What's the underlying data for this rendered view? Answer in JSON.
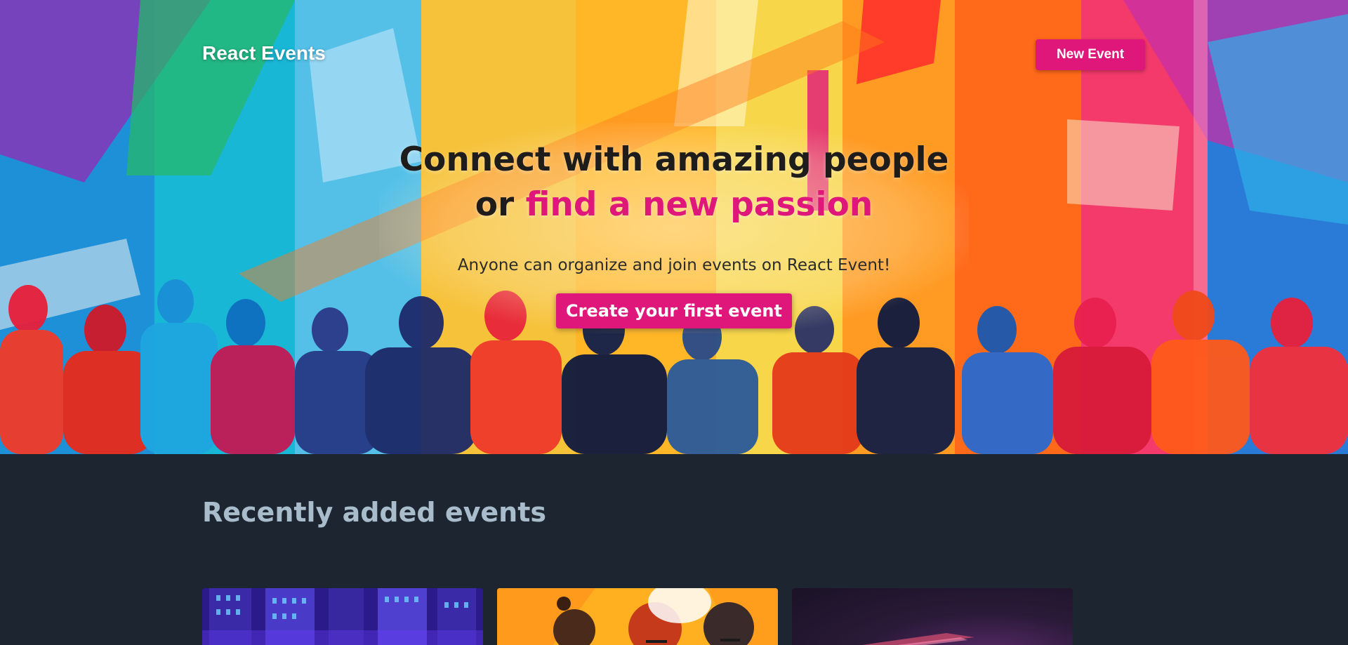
{
  "header": {
    "brand": "React Events",
    "new_event_label": "New Event"
  },
  "hero": {
    "headline_line1": "Connect with amazing people",
    "headline_line2_prefix": "or ",
    "headline_line2_accent": "find a new passion",
    "subline": "Anyone can organize and join events on React Event!",
    "cta_label": "Create your first event"
  },
  "events": {
    "section_title": "Recently added events"
  },
  "theme": {
    "accent": "#e0177a",
    "background": "#1c2530",
    "section_title_color": "#a9bccb"
  }
}
